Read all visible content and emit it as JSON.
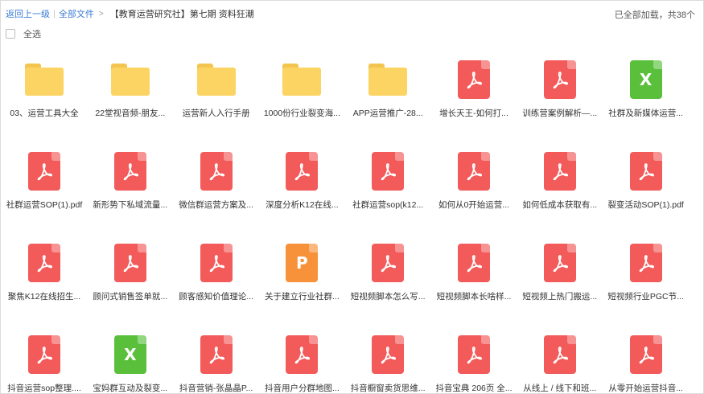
{
  "breadcrumb": {
    "back": "返回上一级",
    "all_files": "全部文件",
    "arrow": ">",
    "path": "【教育运营研究社】第七期 资料狂潮"
  },
  "status": "已全部加载，共38个",
  "select_all": "全选",
  "colors": {
    "link": "#3a7bd5",
    "folder": "#fcd463",
    "pdf": "#f35a5a",
    "xls": "#5ac03c",
    "ppt": "#f7923a"
  },
  "files": [
    {
      "name": "03、运营工具大全",
      "type": "folder",
      "icon": "folder-icon"
    },
    {
      "name": "22堂视音频-朋友...",
      "type": "folder",
      "icon": "folder-icon"
    },
    {
      "name": "运营新人入行手册",
      "type": "folder",
      "icon": "folder-icon"
    },
    {
      "name": "1000份行业裂变海...",
      "type": "folder",
      "icon": "folder-icon"
    },
    {
      "name": "APP运营推广-28...",
      "type": "folder",
      "icon": "folder-icon"
    },
    {
      "name": "增长天王-如何打...",
      "type": "pdf",
      "icon": "pdf-icon"
    },
    {
      "name": "训练营案例解析—...",
      "type": "pdf",
      "icon": "pdf-icon"
    },
    {
      "name": "社群及新媒体运营...",
      "type": "xls",
      "icon": "excel-icon",
      "glyph": "X"
    },
    {
      "name": "社群运营SOP(1).pdf",
      "type": "pdf",
      "icon": "pdf-icon"
    },
    {
      "name": "新形势下私域流量...",
      "type": "pdf",
      "icon": "pdf-icon"
    },
    {
      "name": "微信群运营方案及...",
      "type": "pdf",
      "icon": "pdf-icon"
    },
    {
      "name": "深度分析K12在线...",
      "type": "pdf",
      "icon": "pdf-icon"
    },
    {
      "name": "社群运营sop(k12...",
      "type": "pdf",
      "icon": "pdf-icon"
    },
    {
      "name": "如何从0开始运营...",
      "type": "pdf",
      "icon": "pdf-icon"
    },
    {
      "name": "如何低成本获取有...",
      "type": "pdf",
      "icon": "pdf-icon"
    },
    {
      "name": "裂变活动SOP(1).pdf",
      "type": "pdf",
      "icon": "pdf-icon"
    },
    {
      "name": "聚焦K12在线招生...",
      "type": "pdf",
      "icon": "pdf-icon"
    },
    {
      "name": "顾问式销售签单就...",
      "type": "pdf",
      "icon": "pdf-icon"
    },
    {
      "name": "顾客感知价值理论...",
      "type": "pdf",
      "icon": "pdf-icon"
    },
    {
      "name": "关于建立行业社群...",
      "type": "ppt",
      "icon": "powerpoint-icon",
      "glyph": "P"
    },
    {
      "name": "短视频脚本怎么写...",
      "type": "pdf",
      "icon": "pdf-icon"
    },
    {
      "name": "短视频脚本长啥样...",
      "type": "pdf",
      "icon": "pdf-icon"
    },
    {
      "name": "短视频上热门搬运...",
      "type": "pdf",
      "icon": "pdf-icon"
    },
    {
      "name": "短视频行业PGC节...",
      "type": "pdf",
      "icon": "pdf-icon"
    },
    {
      "name": "抖音运营sop整理....",
      "type": "pdf",
      "icon": "pdf-icon"
    },
    {
      "name": "宝妈群互动及裂变...",
      "type": "xls",
      "icon": "excel-icon",
      "glyph": "X"
    },
    {
      "name": "抖音营销-张晶晶P...",
      "type": "pdf",
      "icon": "pdf-icon"
    },
    {
      "name": "抖音用户分群地图...",
      "type": "pdf",
      "icon": "pdf-icon"
    },
    {
      "name": "抖音橱窗卖货思维...",
      "type": "pdf",
      "icon": "pdf-icon"
    },
    {
      "name": "抖音宝典 206页 全...",
      "type": "pdf",
      "icon": "pdf-icon"
    },
    {
      "name": "从线上 / 线下和班...",
      "type": "pdf",
      "icon": "pdf-icon"
    },
    {
      "name": "从零开始运营抖音...",
      "type": "pdf",
      "icon": "pdf-icon"
    }
  ]
}
